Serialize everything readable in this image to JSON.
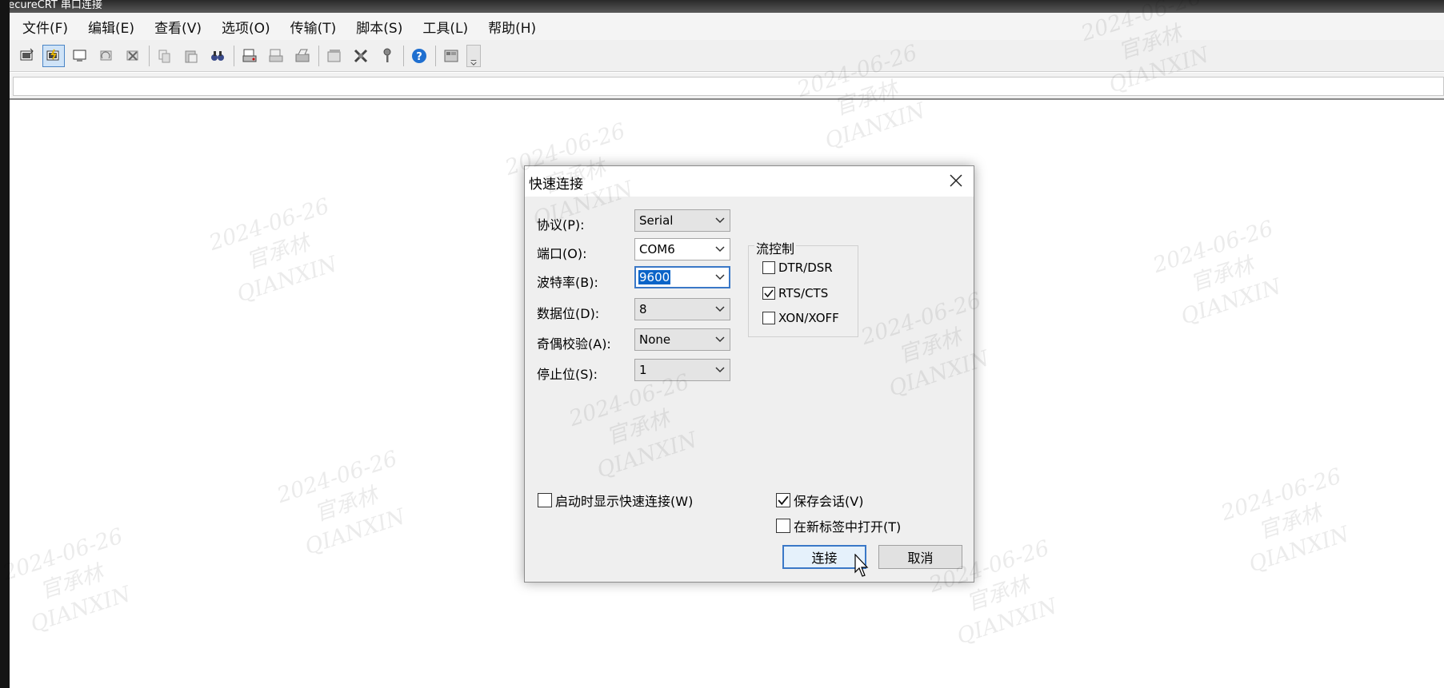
{
  "window": {
    "title": "SecureCRT 串口连接"
  },
  "menubar": {
    "items": [
      {
        "label": "文件(F)"
      },
      {
        "label": "编辑(E)"
      },
      {
        "label": "查看(V)"
      },
      {
        "label": "选项(O)"
      },
      {
        "label": "传输(T)"
      },
      {
        "label": "脚本(S)"
      },
      {
        "label": "工具(L)"
      },
      {
        "label": "帮助(H)"
      }
    ]
  },
  "toolbar": {
    "icons": [
      "connect-icon",
      "quick-connect-icon",
      "connect-in-tab-icon",
      "reconnect-icon",
      "disconnect-icon",
      "copy-icon",
      "paste-icon",
      "find-icon",
      "print-icon",
      "print-selection-icon",
      "print-setup-icon",
      "session-options-icon",
      "global-options-icon",
      "keymap-icon",
      "help-icon",
      "chat-window-icon"
    ]
  },
  "watermark": {
    "date": "2024-06-26",
    "name": "官承林",
    "latin": "QIANXIN"
  },
  "dialog": {
    "title": "快速连接",
    "fields": {
      "protocol": {
        "label": "协议(P):",
        "value": "Serial"
      },
      "port": {
        "label": "端口(O):",
        "value": "COM6"
      },
      "baud": {
        "label": "波特率(B):",
        "value": "9600"
      },
      "databits": {
        "label": "数据位(D):",
        "value": "8"
      },
      "parity": {
        "label": "奇偶校验(A):",
        "value": "None"
      },
      "stopbits": {
        "label": "停止位(S):",
        "value": "1"
      }
    },
    "flow_control": {
      "title": "流控制",
      "options": [
        {
          "label": "DTR/DSR",
          "checked": false
        },
        {
          "label": "RTS/CTS",
          "checked": true
        },
        {
          "label": "XON/XOFF",
          "checked": false
        }
      ]
    },
    "show_on_startup": {
      "label": "启动时显示快速连接(W)",
      "checked": false
    },
    "save_session": {
      "label": "保存会话(V)",
      "checked": true
    },
    "open_in_tab": {
      "label": "在新标签中打开(T)",
      "checked": false
    },
    "buttons": {
      "connect": "连接",
      "cancel": "取消"
    }
  },
  "colors": {
    "accent": "#3a78c7",
    "selection": "#0a64c8",
    "dialog_bg": "#efefef"
  }
}
